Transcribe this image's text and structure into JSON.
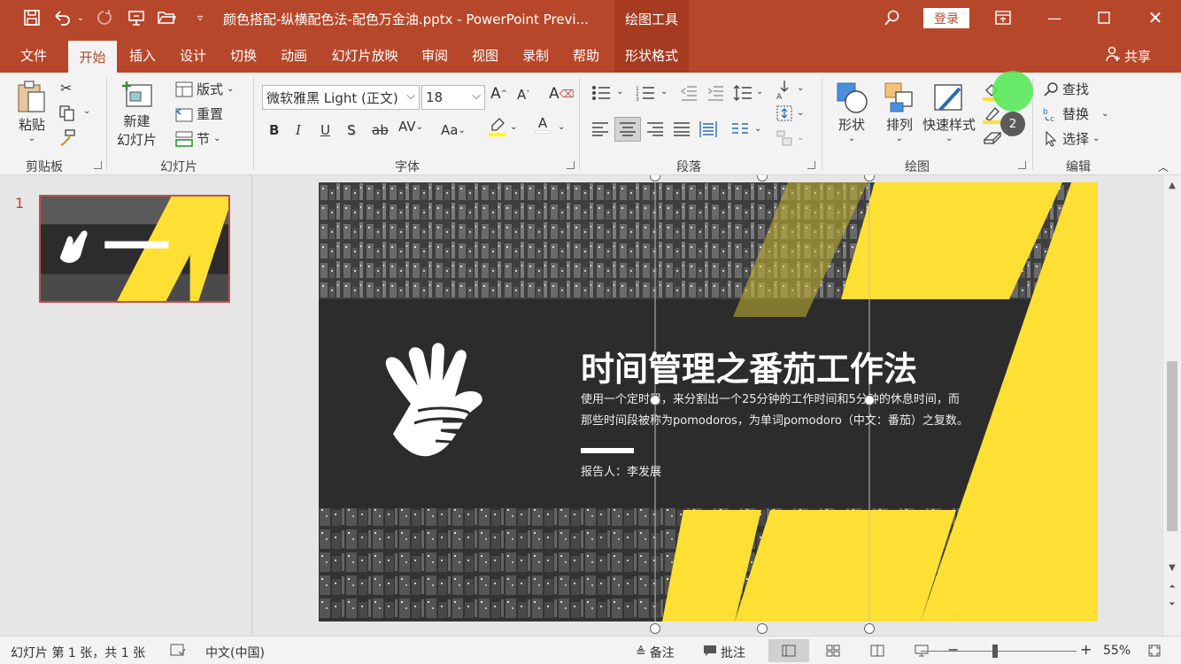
{
  "titlebar": {
    "doc_title": "颜色搭配-纵横配色法-配色万金油.pptx  -  PowerPoint Previ...",
    "context_group": "绘图工具",
    "login": "登录",
    "bg_color": "#b7472a"
  },
  "tabs": [
    {
      "label": "文件"
    },
    {
      "label": "开始"
    },
    {
      "label": "插入"
    },
    {
      "label": "设计"
    },
    {
      "label": "切换"
    },
    {
      "label": "动画"
    },
    {
      "label": "幻灯片放映"
    },
    {
      "label": "审阅"
    },
    {
      "label": "视图"
    },
    {
      "label": "录制"
    },
    {
      "label": "帮助"
    },
    {
      "label": "形状格式"
    }
  ],
  "share": "共享",
  "ribbon": {
    "clipboard": {
      "paste": "粘贴",
      "group": "剪贴板"
    },
    "slides": {
      "new_slide_1": "新建",
      "new_slide_2": "幻灯片",
      "layout": "版式",
      "reset": "重置",
      "section": "节",
      "group": "幻灯片"
    },
    "font": {
      "name": "微软雅黑 Light (正文)",
      "size": "18",
      "group": "字体",
      "bold": "B",
      "italic": "I",
      "underline": "U",
      "shadow": "S",
      "strike": "ab",
      "grow": "A",
      "shrink": "A",
      "case": "Aa",
      "color_letter": "A"
    },
    "paragraph": {
      "group": "段落"
    },
    "drawing": {
      "shapes": "形状",
      "arrange": "排列",
      "quick_styles": "快速样式",
      "group": "绘图"
    },
    "editing": {
      "find": "查找",
      "replace": "替换",
      "select": "选择",
      "group": "编辑"
    },
    "badge": "2"
  },
  "thumbnail": {
    "number": "1",
    "title": "时间管理之番茄工作法"
  },
  "slide": {
    "title": "时间管理之番茄工作法",
    "body_line1": "使用一个定时器，来分割出一个25分钟的工作时间和5分钟的休息时间，而",
    "body_line2": "那些时间段被称为pomodoros，为单词pomodoro（中文：番茄）之复数。",
    "presenter": "报告人：李发展",
    "accent_color": "#fde033",
    "band_color": "#2c2c2c"
  },
  "statusbar": {
    "slide_info": "幻灯片 第 1 张，共 1 张",
    "language": "中文(中国)",
    "notes": "备注",
    "comments": "批注",
    "zoom": "55%"
  }
}
